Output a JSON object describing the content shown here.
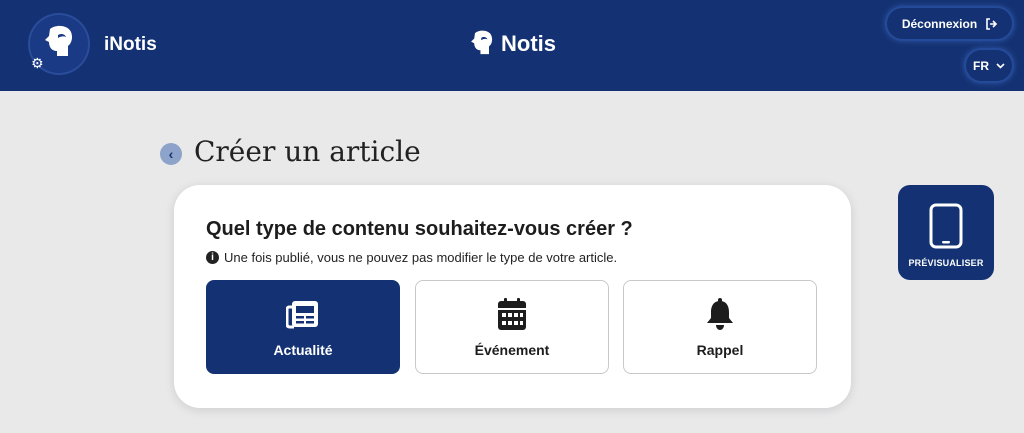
{
  "header": {
    "app_name": "iNotis",
    "brand_name": "Notis",
    "logout_label": "Déconnexion",
    "language": "FR",
    "icons": {
      "avatar": "user-profile-icon",
      "settings": "gear-icon",
      "logout": "logout-icon",
      "language_toggle": "chevron-down-icon"
    }
  },
  "page": {
    "title": "Créer un article",
    "back_icon": "chevron-left-icon"
  },
  "card": {
    "question": "Quel type de contenu souhaitez-vous créer ?",
    "info_text": "Une fois publié, vous ne pouvez pas modifier le type de votre article.",
    "options": [
      {
        "label": "Actualité",
        "icon": "newspaper-icon",
        "selected": true
      },
      {
        "label": "Événement",
        "icon": "calendar-icon",
        "selected": false
      },
      {
        "label": "Rappel",
        "icon": "bell-icon",
        "selected": false
      }
    ]
  },
  "preview": {
    "label": "PRÉVISUALISER",
    "icon": "smartphone-icon"
  },
  "colors": {
    "primary": "#143273",
    "background": "#e9e9ea",
    "card": "#ffffff"
  }
}
